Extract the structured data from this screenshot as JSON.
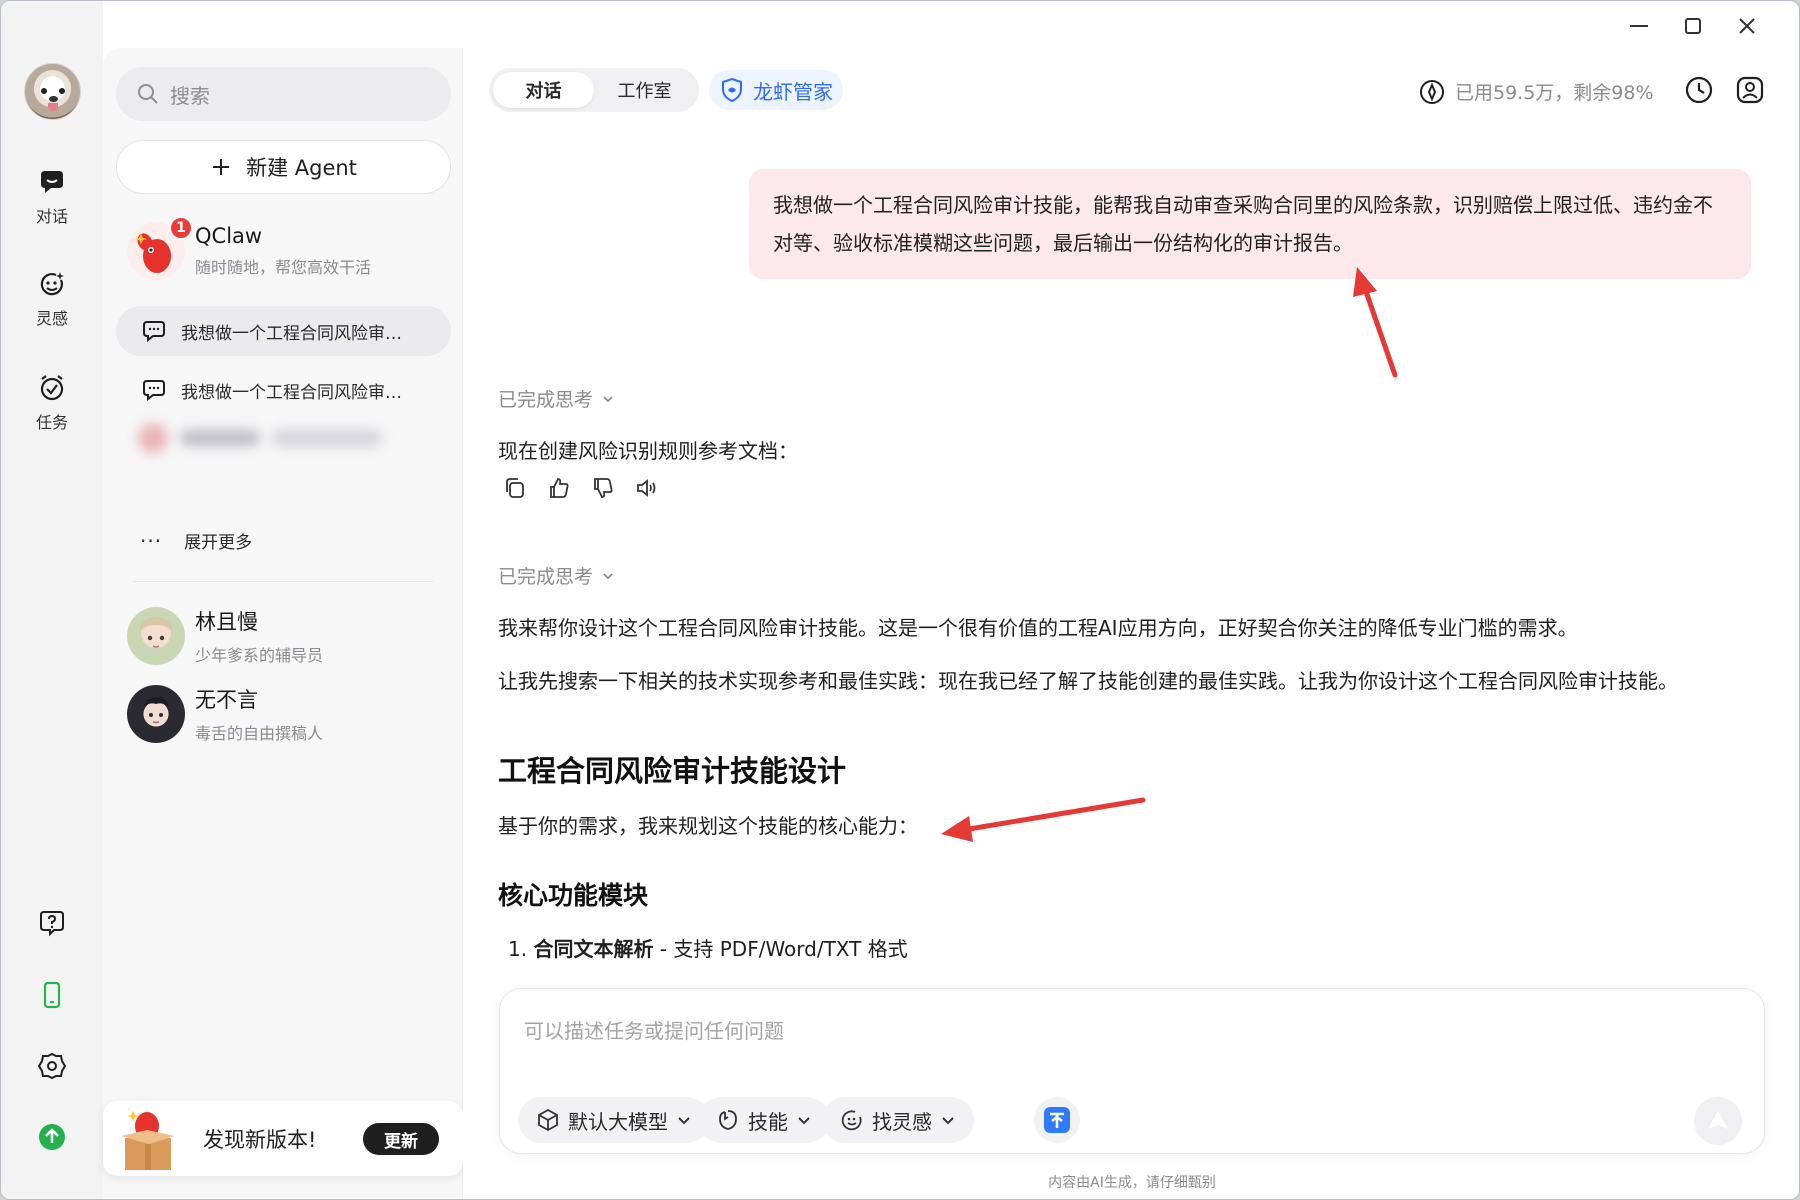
{
  "window_controls": {
    "minimize": "minimize-icon",
    "maximize": "maximize-icon",
    "close": "close-icon"
  },
  "rail": {
    "items": [
      {
        "label": "对话",
        "icon": "chat-bubble-icon"
      },
      {
        "label": "灵感",
        "icon": "inspiration-face-icon"
      },
      {
        "label": "任务",
        "icon": "task-clock-icon"
      }
    ],
    "bottom_icons": [
      "help-icon",
      "phone-icon",
      "settings-icon",
      "upgrade-icon"
    ]
  },
  "sidebar": {
    "search_placeholder": "搜索",
    "new_agent_label": "新建 Agent",
    "agents": [
      {
        "name": "QClaw",
        "desc": "随时随地，帮您高效干活",
        "badge": "1"
      }
    ],
    "conversations": [
      {
        "title": "我想做一个工程合同风险审…",
        "active": true
      },
      {
        "title": "我想做一个工程合同风险审…",
        "active": false
      }
    ],
    "expand_more": "展开更多",
    "contacts": [
      {
        "name": "林且慢",
        "desc": "少年爹系的辅导员"
      },
      {
        "name": "无不言",
        "desc": "毒舌的自由撰稿人"
      }
    ],
    "update": {
      "text": "发现新版本!",
      "button": "更新"
    }
  },
  "header": {
    "tabs": [
      {
        "label": "对话",
        "active": true
      },
      {
        "label": "工作室",
        "active": false
      }
    ],
    "butler_label": "龙虾管家",
    "quota_text": "已用59.5万，剩余98%"
  },
  "chat": {
    "user_message": "我想做一个工程合同风险审计技能，能帮我自动审查采购合同里的风险条款，识别赔偿上限过低、违约金不对等、验收标准模糊这些问题，最后输出一份结构化的审计报告。",
    "thinking_1": "已完成思考",
    "reply_1": "现在创建风险识别规则参考文档：",
    "thinking_2": "已完成思考",
    "reply_2a": "我来帮你设计这个工程合同风险审计技能。这是一个很有价值的工程AI应用方向，正好契合你关注的降低专业门槛的需求。",
    "reply_2b": "让我先搜索一下相关的技术实现参考和最佳实践：现在我已经了解了技能创建的最佳实践。让我为你设计这个工程合同风险审计技能。",
    "heading": "工程合同风险审计技能设计",
    "intro": "基于你的需求，我来规划这个技能的核心能力：",
    "subheading": "核心功能模块",
    "list_number": "1.",
    "list_bold": "合同文本解析",
    "list_rest": " - 支持 PDF/Word/TXT 格式"
  },
  "composer": {
    "placeholder": "可以描述任务或提问任何问题",
    "model_label": "默认大模型",
    "skill_label": "技能",
    "inspiration_label": "找灵感"
  },
  "footer_note": "内容由AI生成，请仔细甄别",
  "annotation_color": "#e53935"
}
